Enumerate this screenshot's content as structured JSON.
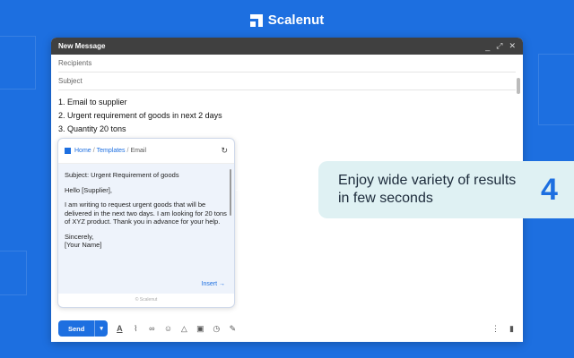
{
  "brand": {
    "name": "Scalenut"
  },
  "composer": {
    "title": "New Message",
    "controls": [
      "_",
      "⤢",
      "✕"
    ],
    "recipients_placeholder": "Recipients",
    "subject_placeholder": "Subject",
    "body_lines": [
      "1. Email to supplier",
      "2. Urgent requirement of goods in next 2 days",
      "3. Quantity 20 tons"
    ]
  },
  "popup": {
    "crumbs": {
      "home": "Home",
      "templates": "Templates",
      "current": "Email",
      "sep": "/"
    },
    "result": {
      "subject": "Subject: Urgent Requirement of goods",
      "greeting": "Hello [Supplier],",
      "paragraph": "I am writing to request urgent goods that will be delivered in the next two days. I am looking for 20 tons of XYZ product. Thank you in advance for your help.",
      "closing": "Sincerely,",
      "signature": "[Your Name]"
    },
    "insert_label": "Insert →",
    "footer": "© Scalenut"
  },
  "toolbar": {
    "send_label": "Send",
    "send_arrow": "▾"
  },
  "callout": {
    "text": "Enjoy wide variety of results in few seconds",
    "number": "4"
  },
  "colors": {
    "brand_blue": "#1d6fe0",
    "callout_bg": "#dff1f3",
    "titlebar": "#404040"
  }
}
